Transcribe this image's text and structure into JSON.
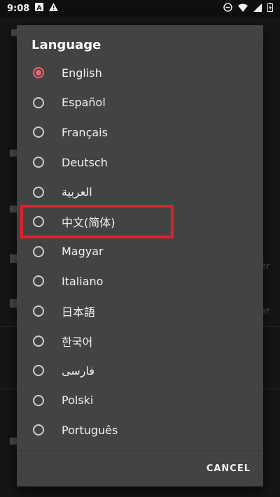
{
  "status_bar": {
    "time": "9:08",
    "icons": [
      "a-notification-icon",
      "warning-icon",
      "do-not-disturb-icon",
      "wifi-icon",
      "signal-icon",
      "battery-icon"
    ]
  },
  "dialog": {
    "title": "Language",
    "selected": "English",
    "options": [
      {
        "label": "English",
        "checked": true
      },
      {
        "label": "Español",
        "checked": false
      },
      {
        "label": "Français",
        "checked": false
      },
      {
        "label": "Deutsch",
        "checked": false
      },
      {
        "label": "العربية",
        "checked": false
      },
      {
        "label": "中文(简体)",
        "checked": false
      },
      {
        "label": "Magyar",
        "checked": false
      },
      {
        "label": "Italiano",
        "checked": false
      },
      {
        "label": "日本語",
        "checked": false
      },
      {
        "label": "한국어",
        "checked": false
      },
      {
        "label": "فارسی",
        "checked": false
      },
      {
        "label": "Polski",
        "checked": false
      },
      {
        "label": "Português",
        "checked": false
      }
    ],
    "cancel_label": "CANCEL"
  },
  "background": {
    "partial_texts": [
      "er",
      "er"
    ]
  },
  "colors": {
    "accent": "#f06272",
    "highlight": "#e0202a",
    "dialog_bg": "#434343"
  }
}
